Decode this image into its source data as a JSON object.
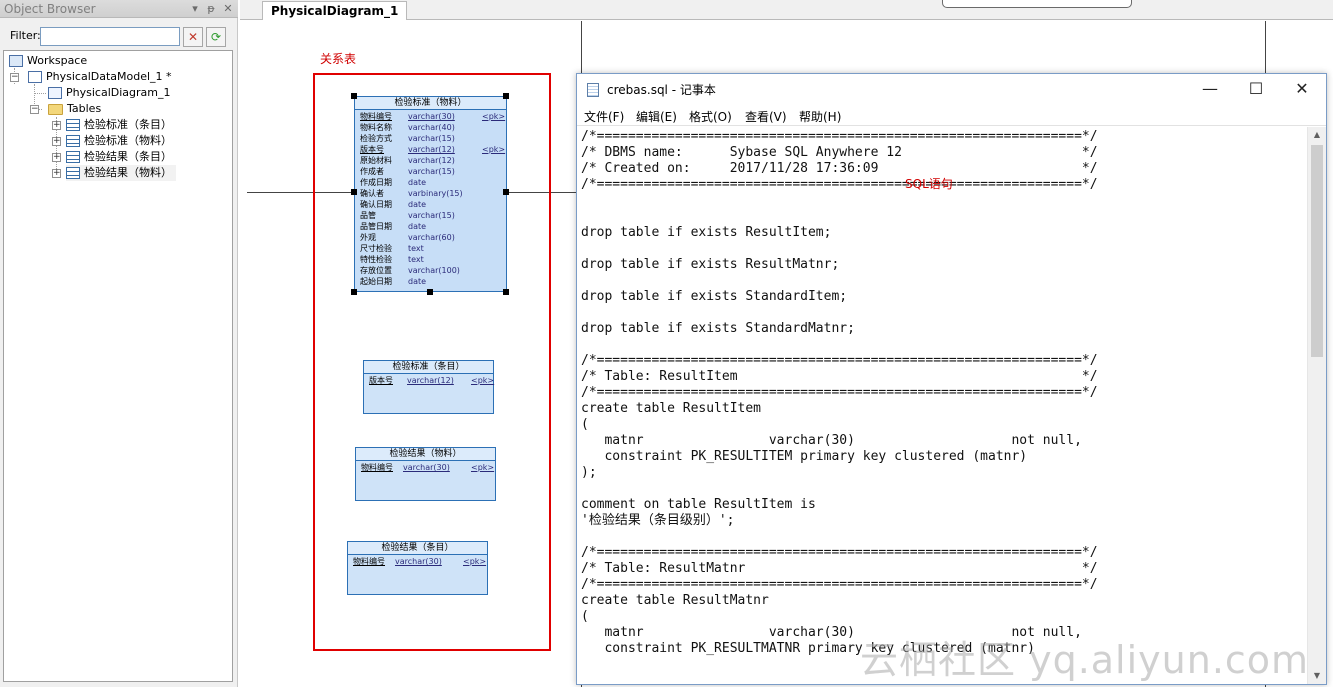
{
  "object_browser": {
    "title": "Object Browser",
    "controls": [
      "▾",
      "ᵽ",
      "✕"
    ],
    "filter_label": "Filter:",
    "filter_value": "",
    "tree": {
      "workspace": "Workspace",
      "model": "PhysicalDataModel_1 *",
      "diagram": "PhysicalDiagram_1",
      "tables_folder": "Tables",
      "tables": [
        "检验标准（条目）",
        "检验标准（物料）",
        "检验结果（条目）",
        "检验结果（物料）"
      ]
    }
  },
  "tabs": {
    "active": "PhysicalDiagram_1"
  },
  "canvas": {
    "relation_label": "关系表",
    "entities": [
      {
        "title": "检验标准（物料）",
        "columns": [
          {
            "name": "物料编号",
            "type": "varchar(30)",
            "key": "<pk>"
          },
          {
            "name": "物料名称",
            "type": "varchar(40)",
            "key": ""
          },
          {
            "name": "检验方式",
            "type": "varchar(15)",
            "key": ""
          },
          {
            "name": "版本号",
            "type": "varchar(12)",
            "key": "<pk>"
          },
          {
            "name": "原始材料",
            "type": "varchar(12)",
            "key": ""
          },
          {
            "name": "作成者",
            "type": "varchar(15)",
            "key": ""
          },
          {
            "name": "作成日期",
            "type": "date",
            "key": ""
          },
          {
            "name": "确认者",
            "type": "varbinary(15)",
            "key": ""
          },
          {
            "name": "确认日期",
            "type": "date",
            "key": ""
          },
          {
            "name": "品管",
            "type": "varchar(15)",
            "key": ""
          },
          {
            "name": "品管日期",
            "type": "date",
            "key": ""
          },
          {
            "name": "外观",
            "type": "varchar(60)",
            "key": ""
          },
          {
            "name": "尺寸检验",
            "type": "text",
            "key": ""
          },
          {
            "name": "特性检验",
            "type": "text",
            "key": ""
          },
          {
            "name": "存放位置",
            "type": "varchar(100)",
            "key": ""
          },
          {
            "name": "起始日期",
            "type": "date",
            "key": ""
          }
        ]
      },
      {
        "title": "检验标准（条目）",
        "columns": [
          {
            "name": "版本号",
            "type": "varchar(12)",
            "key": "<pk>"
          }
        ]
      },
      {
        "title": "检验结果（物料）",
        "columns": [
          {
            "name": "物料编号",
            "type": "varchar(30)",
            "key": "<pk>"
          }
        ]
      },
      {
        "title": "检验结果（条目）",
        "columns": [
          {
            "name": "物料编号",
            "type": "varchar(30)",
            "key": "<pk>"
          }
        ]
      }
    ]
  },
  "notepad": {
    "title": "crebas.sql - 记事本",
    "menus": [
      "文件(F)",
      "编辑(E)",
      "格式(O)",
      "查看(V)",
      "帮助(H)"
    ],
    "window_controls": [
      "—",
      "☐",
      "✕"
    ],
    "annotation": "SQL语句",
    "lines": [
      "/*==============================================================*/",
      "/* DBMS name:      Sybase SQL Anywhere 12                       */",
      "/* Created on:     2017/11/28 17:36:09                          */",
      "/*==============================================================*/",
      "",
      "",
      "drop table if exists ResultItem;",
      "",
      "drop table if exists ResultMatnr;",
      "",
      "drop table if exists StandardItem;",
      "",
      "drop table if exists StandardMatnr;",
      "",
      "/*==============================================================*/",
      "/* Table: ResultItem                                            */",
      "/*==============================================================*/",
      "create table ResultItem",
      "(",
      "   matnr                varchar(30)                    not null,",
      "   constraint PK_RESULTITEM primary key clustered (matnr)",
      ");",
      "",
      "comment on table ResultItem is",
      "'检验结果（条目级别）';",
      "",
      "/*==============================================================*/",
      "/* Table: ResultMatnr                                           */",
      "/*==============================================================*/",
      "create table ResultMatnr",
      "(",
      "   matnr                varchar(30)                    not null,",
      "   constraint PK_RESULTMATNR primary key clustered (matnr)"
    ]
  },
  "watermark": "云栖社区 yq.aliyun.com"
}
